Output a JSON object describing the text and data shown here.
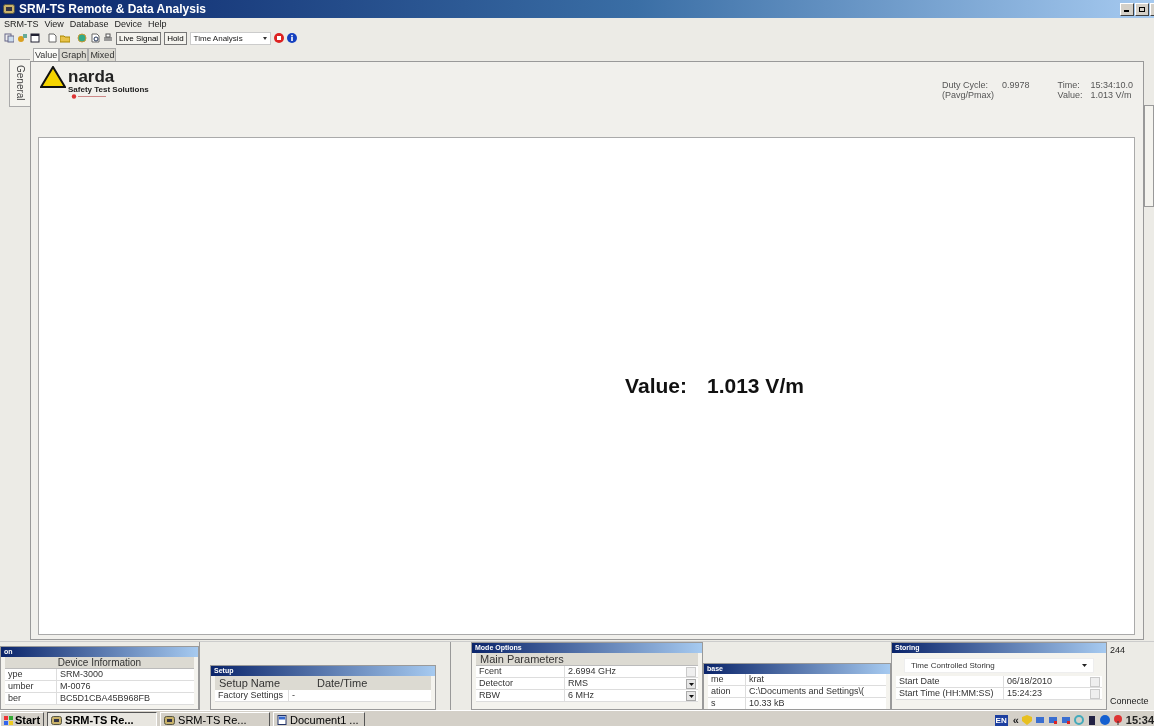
{
  "window": {
    "title": "SRM-TS Remote & Data Analysis"
  },
  "menu": [
    "SRM-TS",
    "View",
    "Database",
    "Device",
    "Help"
  ],
  "toolbar": {
    "buttons": [
      {
        "label": "Live Signal"
      },
      {
        "label": "Hold"
      }
    ],
    "mode_select": "Time Analysis"
  },
  "side_tabs": [
    {
      "label": "General",
      "selected": true
    }
  ],
  "tabs": [
    {
      "label": "Value",
      "selected": true
    },
    {
      "label": "Graph",
      "selected": false
    },
    {
      "label": "Mixed",
      "selected": false
    }
  ],
  "logo": {
    "name": "narda",
    "tagline": "Safety Test Solutions"
  },
  "readouts": {
    "duty_label": "Duty Cycle:",
    "duty_value": "0.9978",
    "duty_sub": "(Pavg/Pmax)",
    "time_label": "Time:",
    "time_value": "15:34:10.0",
    "value_label": "Value:",
    "value_value": "1.013 V/m"
  },
  "display": {
    "label": "Value:",
    "value": "1.013 V/m"
  },
  "panels": [
    {
      "title": "on",
      "header": "Device Information",
      "rows": [
        {
          "cells": [
            "ype",
            "SRM-3000"
          ]
        },
        {
          "cells": [
            "umber",
            "M-0076"
          ]
        },
        {
          "cells": [
            "ber",
            "BC5D1CBA45B968FB"
          ]
        }
      ]
    },
    {
      "title": "Setup",
      "columns": [
        "Setup Name",
        "Date/Time"
      ],
      "rows": [
        {
          "cells": [
            "Factory Settings",
            "-"
          ]
        }
      ]
    },
    {
      "title": "Mode Options",
      "header": "Main Parameters",
      "rows": [
        {
          "cells": [
            "Fcent",
            "2.6994 GHz"
          ],
          "dropdown": false
        },
        {
          "cells": [
            "Detector",
            "RMS"
          ],
          "dropdown": true
        },
        {
          "cells": [
            "RBW",
            "6 MHz"
          ],
          "dropdown": true
        }
      ]
    },
    {
      "title": "base",
      "rows": [
        {
          "cells": [
            "me",
            "krat"
          ]
        },
        {
          "cells": [
            "ation",
            "C:\\Documents and Settings\\("
          ]
        },
        {
          "cells": [
            "s",
            "10.33 kB"
          ]
        }
      ]
    },
    {
      "title": "Storing",
      "select": "Time Controlled Storing",
      "rows": [
        {
          "cells": [
            "Start Date",
            "06/18/2010"
          ],
          "dropdown": false
        },
        {
          "cells": [
            "Start Time (HH:MM:SS)",
            "15:24:23"
          ],
          "dropdown": false
        }
      ]
    }
  ],
  "status": {
    "count": "244",
    "connection": "Connecte"
  },
  "taskbar": {
    "start": "Start",
    "items": [
      {
        "label": "SRM-TS Re...",
        "selected": true
      },
      {
        "label": "SRM-TS Re...",
        "selected": false
      },
      {
        "label": "Document1 ...",
        "selected": false
      }
    ],
    "language": "EN",
    "expand": "«",
    "clock": "15:34"
  }
}
